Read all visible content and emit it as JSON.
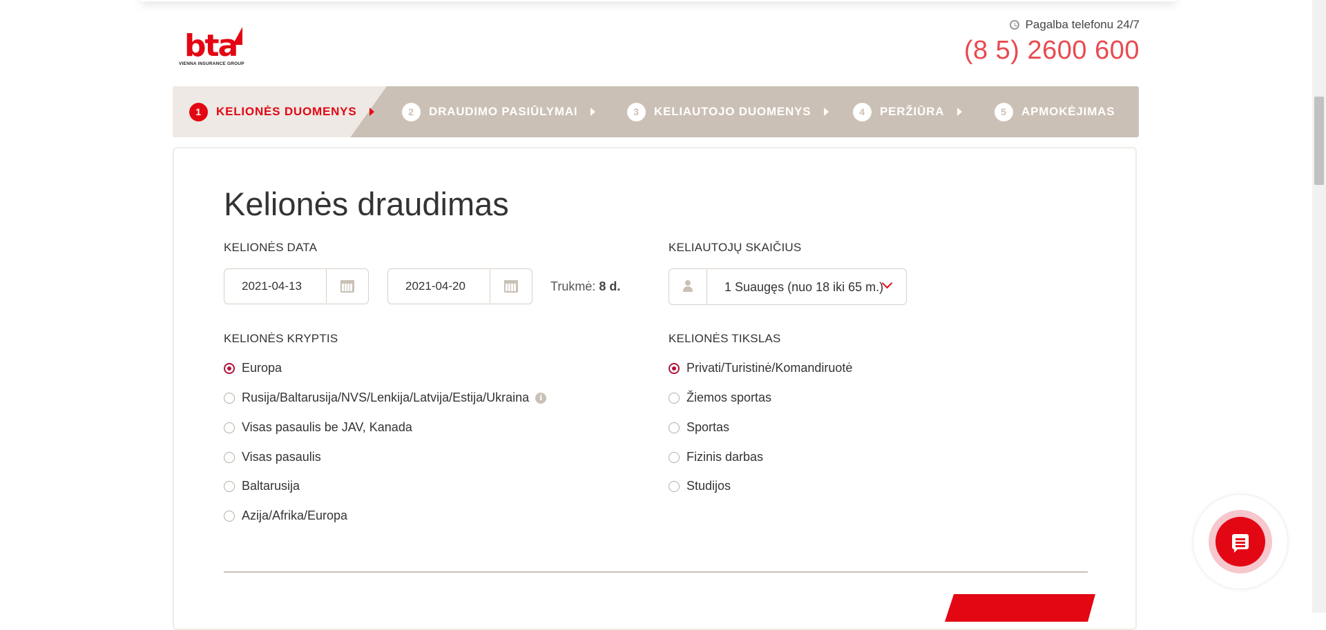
{
  "header": {
    "logo_text": "bta",
    "logo_subtext": "VIENNA INSURANCE GROUP",
    "help_text": "Pagalba telefonu 24/7",
    "phone": "(8 5) 2600 600"
  },
  "steps": [
    {
      "num": "1",
      "label": "KELIONĖS DUOMENYS",
      "active": true
    },
    {
      "num": "2",
      "label": "DRAUDIMO PASIŪLYMAI",
      "active": false
    },
    {
      "num": "3",
      "label": "KELIAUTOJO DUOMENYS",
      "active": false
    },
    {
      "num": "4",
      "label": "PERŽIŪRA",
      "active": false
    },
    {
      "num": "5",
      "label": "APMOKĖJIMAS",
      "active": false
    }
  ],
  "form": {
    "title": "Kelionės draudimas",
    "trip_date_label": "KELIONĖS DATA",
    "date_from": "2021-04-13",
    "date_to": "2021-04-20",
    "duration_label": "Trukmė:",
    "duration_value": "8 d.",
    "travelers_label": "KELIAUTOJŲ SKAIČIUS",
    "travelers_value": "1 Suaugęs (nuo 18 iki 65 m.)",
    "direction_label": "KELIONĖS KRYPTIS",
    "directions": [
      {
        "label": "Europa",
        "selected": true
      },
      {
        "label": "Rusija/Baltarusija/NVS/Lenkija/Latvija/Estija/Ukraina",
        "selected": false,
        "info": "i"
      },
      {
        "label": "Visas pasaulis be JAV, Kanada",
        "selected": false
      },
      {
        "label": "Visas pasaulis",
        "selected": false
      },
      {
        "label": "Baltarusija",
        "selected": false
      },
      {
        "label": "Azija/Afrika/Europa",
        "selected": false
      }
    ],
    "purpose_label": "KELIONĖS TIKSLAS",
    "purposes": [
      {
        "label": "Privati/Turistinė/Komandiruotė",
        "selected": true
      },
      {
        "label": "Žiemos sportas",
        "selected": false
      },
      {
        "label": "Sportas",
        "selected": false
      },
      {
        "label": "Fizinis darbas",
        "selected": false
      },
      {
        "label": "Studijos",
        "selected": false
      }
    ]
  },
  "colors": {
    "brand": "#e30613",
    "steps_bg": "#cbc0b5",
    "radio_selected": "#b0133a"
  },
  "icons": [
    "clock-icon",
    "calendar-icon",
    "person-icon",
    "chevron-down-icon",
    "info-icon",
    "chat-icon"
  ]
}
